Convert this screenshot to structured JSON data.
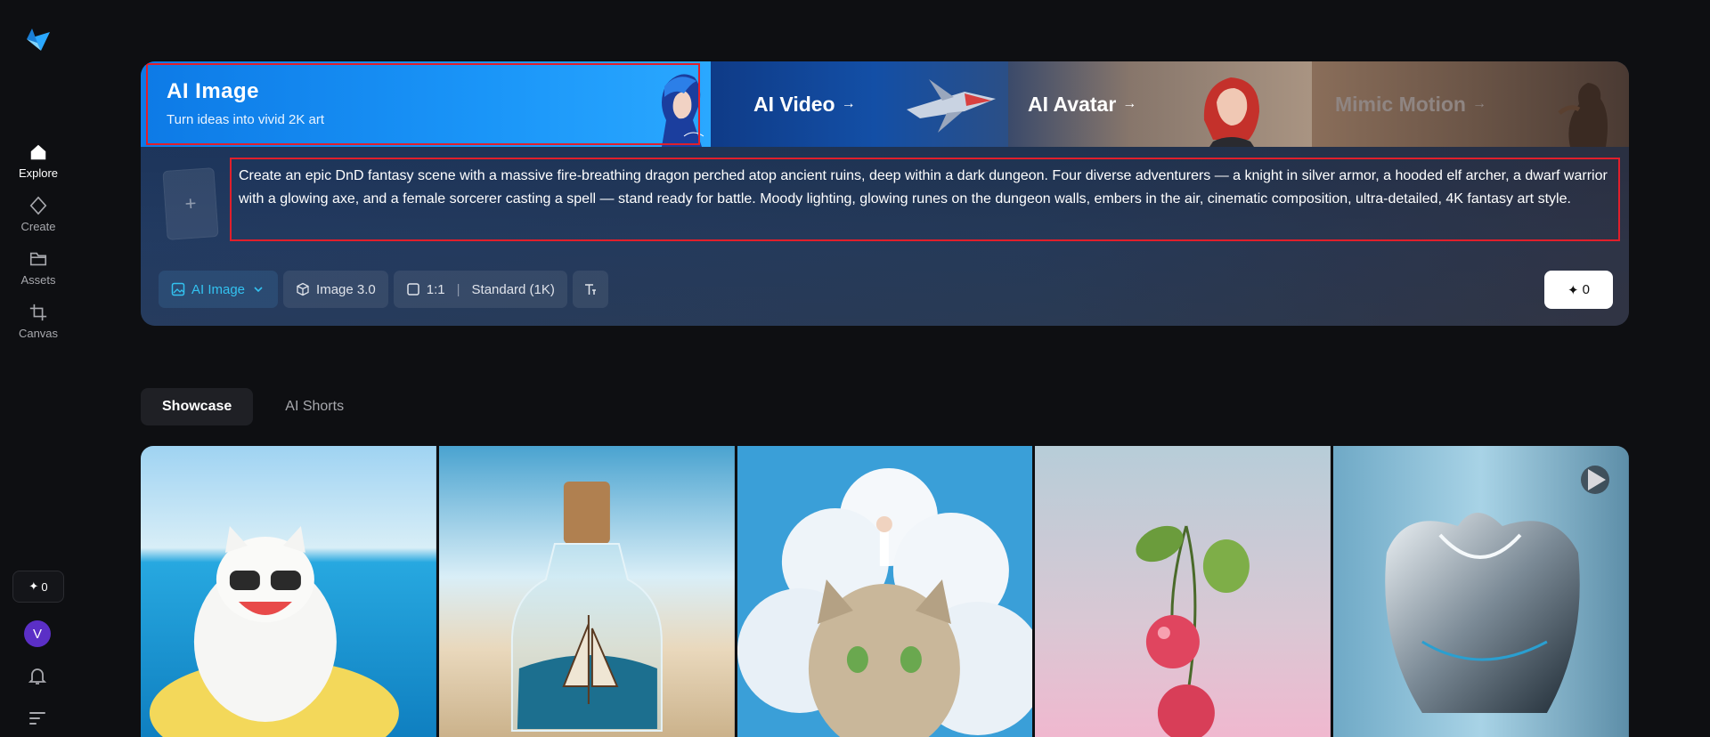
{
  "sidebar": {
    "items": [
      {
        "label": "Explore",
        "icon": "home-icon"
      },
      {
        "label": "Create",
        "icon": "diamond-icon"
      },
      {
        "label": "Assets",
        "icon": "folder-icon"
      },
      {
        "label": "Canvas",
        "icon": "crop-icon"
      }
    ],
    "credits": "0",
    "avatar_initial": "V"
  },
  "hero": {
    "tabs": {
      "image_title": "AI Image",
      "image_subtitle": "Turn ideas into vivid 2K art",
      "video_label": "AI Video",
      "avatar_label": "AI Avatar",
      "mimic_label": "Mimic Motion",
      "arrow": "→"
    },
    "upload_plus": "+",
    "prompt_text": "Create an epic DnD fantasy scene with a massive fire-breathing dragon perched atop ancient ruins, deep within a dark dungeon. Four diverse adventurers — a knight in silver armor, a hooded elf archer, a dwarf warrior with a glowing axe, and a female sorcerer casting a spell — stand ready for battle. Moody lighting, glowing runes on the dungeon walls, embers in the air, cinematic composition, ultra-detailed, 4K fantasy art style.",
    "toolbar": {
      "mode_label": "AI Image",
      "model_label": "Image 3.0",
      "ratio_label": "1:1",
      "quality_label": "Standard (1K)"
    },
    "generate_cost": "0"
  },
  "showcase": {
    "tabs": [
      "Showcase",
      "AI Shorts"
    ]
  },
  "colors": {
    "accent": "#33c2f0",
    "highlight_border": "#e11f2b",
    "avatar_bg": "#5b2fc6"
  }
}
